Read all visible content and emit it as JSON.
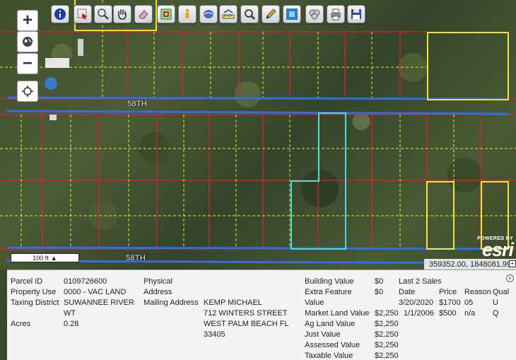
{
  "toolbar": {
    "tools": [
      {
        "name": "identify-icon"
      },
      {
        "name": "select-parcel-icon"
      },
      {
        "name": "zoom-to-icon"
      },
      {
        "name": "pan-hand-icon"
      },
      {
        "name": "eraser-icon"
      },
      {
        "name": "select-area-icon"
      },
      {
        "name": "street-view-icon"
      },
      {
        "name": "layers-icon"
      },
      {
        "name": "measure-icon"
      },
      {
        "name": "search-icon"
      },
      {
        "name": "draw-pencil-icon"
      },
      {
        "name": "full-extent-icon"
      },
      {
        "name": "buffer-icon"
      },
      {
        "name": "print-icon"
      },
      {
        "name": "save-icon"
      }
    ]
  },
  "zoom": {
    "plus": "+",
    "minus": "−"
  },
  "map": {
    "road_labels": [
      "58TH",
      "58TH"
    ],
    "scale_label": "100 ft",
    "esri_powered": "POWERED BY",
    "esri_wordmark": "esri",
    "coordinates": "359352.00, 1848081.99",
    "colors": {
      "parcel_line": "#e0202a",
      "lot_line": "#f0e040",
      "road_line": "#2f6fe0",
      "selected": "#40e0e0",
      "highlight": "#f2e23a"
    }
  },
  "parcel": {
    "parcel_id_label": "Parcel ID",
    "parcel_id": "0109726600",
    "property_use_label": "Property Use",
    "property_use": "0000 - VAC LAND",
    "taxing_district_label": "Taxing District",
    "taxing_district_1": "SUWANNEE RIVER",
    "taxing_district_2": "WT",
    "acres_label": "Acres",
    "acres": "0.28",
    "physical_label_1": "Physical",
    "physical_label_2": "Address",
    "mailing_label": "Mailing Address",
    "mailing_1": "KEMP MICHAEL",
    "mailing_2": "712 WINTERS STREET",
    "mailing_3": "WEST PALM BEACH FL",
    "mailing_4": "33405"
  },
  "values": {
    "building_label": "Building Value",
    "building": "$0",
    "extra_label_1": "Extra Feature",
    "extra_label_2": "Value",
    "extra": "$0",
    "market_label": "Market Land Value",
    "market": "$2,250",
    "ag_label": "Ag Land Value",
    "ag": "$2,250",
    "just_label": "Just Value",
    "just": "$2,250",
    "assessed_label": "Assessed Value",
    "assessed": "$2,250",
    "taxable_label": "Taxable Value",
    "taxable": "$2,250"
  },
  "sales": {
    "title": "Last 2 Sales",
    "headers": [
      "Date",
      "Price",
      "Reason",
      "Qual"
    ],
    "rows": [
      [
        "3/20/2020",
        "$1700",
        "05",
        "U"
      ],
      [
        "1/1/2006",
        "$500",
        "n/a",
        "Q"
      ]
    ]
  },
  "close": "×"
}
